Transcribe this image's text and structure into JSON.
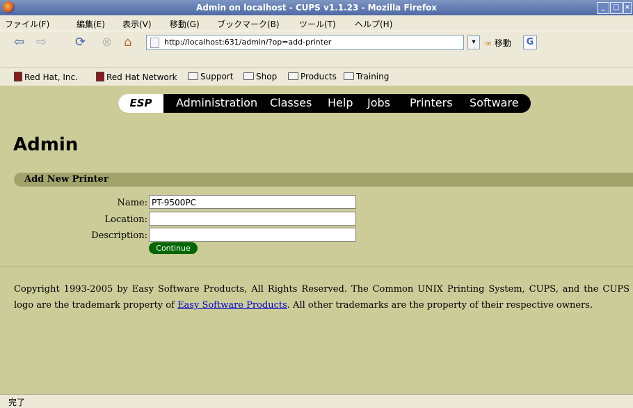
{
  "window": {
    "title": "Admin on localhost - CUPS v1.1.23 - Mozilla Firefox"
  },
  "menu": [
    "ファイル(F)",
    "編集(E)",
    "表示(V)",
    "移動(G)",
    "ブックマーク(B)",
    "ツール(T)",
    "ヘルプ(H)"
  ],
  "address": {
    "url": "http://localhost:631/admin/?op=add-printer",
    "go_label": "移動"
  },
  "bookmarks": [
    "Red Hat, Inc.",
    "Red Hat Network",
    "Support",
    "Shop",
    "Products",
    "Training"
  ],
  "cups_nav": {
    "esp": "ESP",
    "links": [
      "Administration",
      "Classes",
      "Help",
      "Jobs",
      "Printers",
      "Software"
    ]
  },
  "page": {
    "title": "Admin",
    "section": "Add New Printer",
    "form": {
      "name_label": "Name:",
      "name_value": "PT-9500PC",
      "location_label": "Location:",
      "location_value": "",
      "description_label": "Description:",
      "description_value": "",
      "continue_label": "Continue"
    },
    "copyright_before": "Copyright 1993-2005 by Easy Software Products, All Rights Reserved. The Common UNIX Printing System, CUPS, and the CUPS logo are the trademark property of ",
    "copyright_link": "Easy Software Products",
    "copyright_after": ". All other trademarks are the property of their respective owners."
  },
  "status": "完了"
}
